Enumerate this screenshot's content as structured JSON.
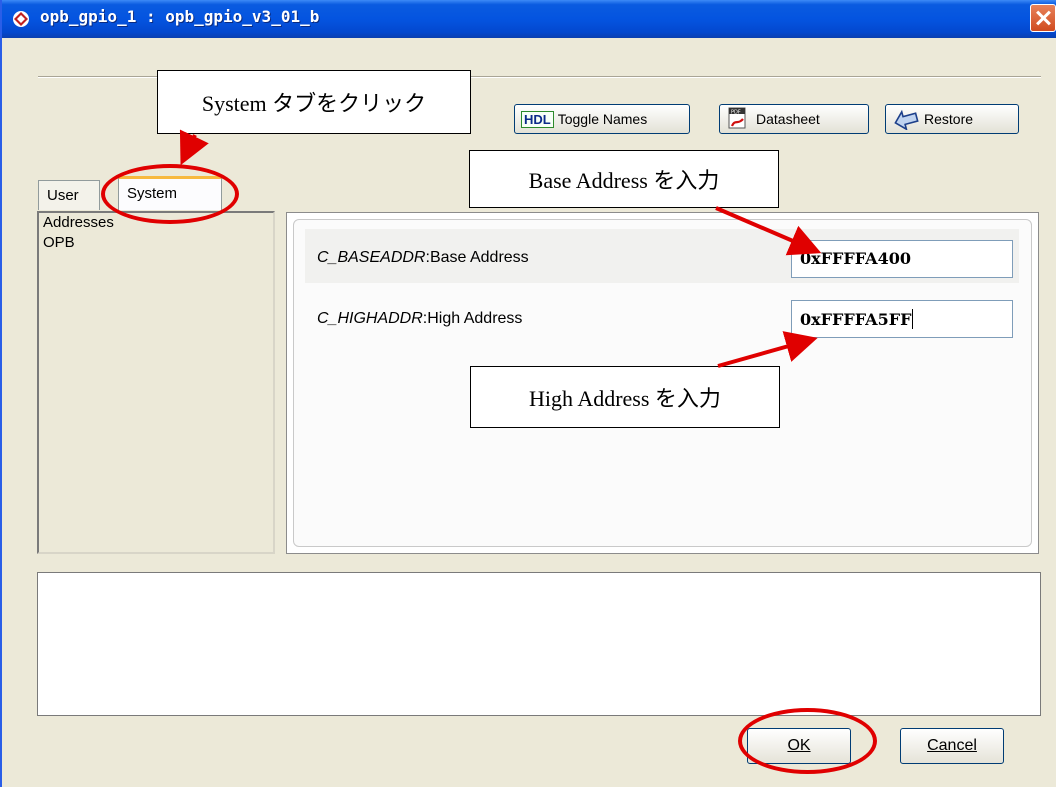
{
  "window": {
    "title": "opb_gpio_1 : opb_gpio_v3_01_b"
  },
  "toolbar": {
    "hdl_badge": "HDL",
    "toggle_names": "Toggle Names",
    "datasheet": "Datasheet",
    "restore": "Restore"
  },
  "tabs": [
    {
      "label": "User",
      "selected": false
    },
    {
      "label": "System",
      "selected": true
    }
  ],
  "sidebar": {
    "items": [
      "Addresses",
      "OPB"
    ]
  },
  "params": [
    {
      "name": "C_BASEADDR",
      "label": "Base Address",
      "value": "0xFFFFA400"
    },
    {
      "name": "C_HIGHADDR",
      "label": "High Address",
      "value": "0xFFFFA5FF"
    }
  ],
  "buttons": {
    "ok": "OK",
    "cancel": "Cancel"
  },
  "annotations": {
    "system_tab": "System タブをクリック",
    "base_address": "Base Address を入力",
    "high_address": "High Address を入力"
  },
  "colors": {
    "title_bar": "#0454e0",
    "annotation_red": "#e00000",
    "tab_highlight": "#f7b93f"
  }
}
